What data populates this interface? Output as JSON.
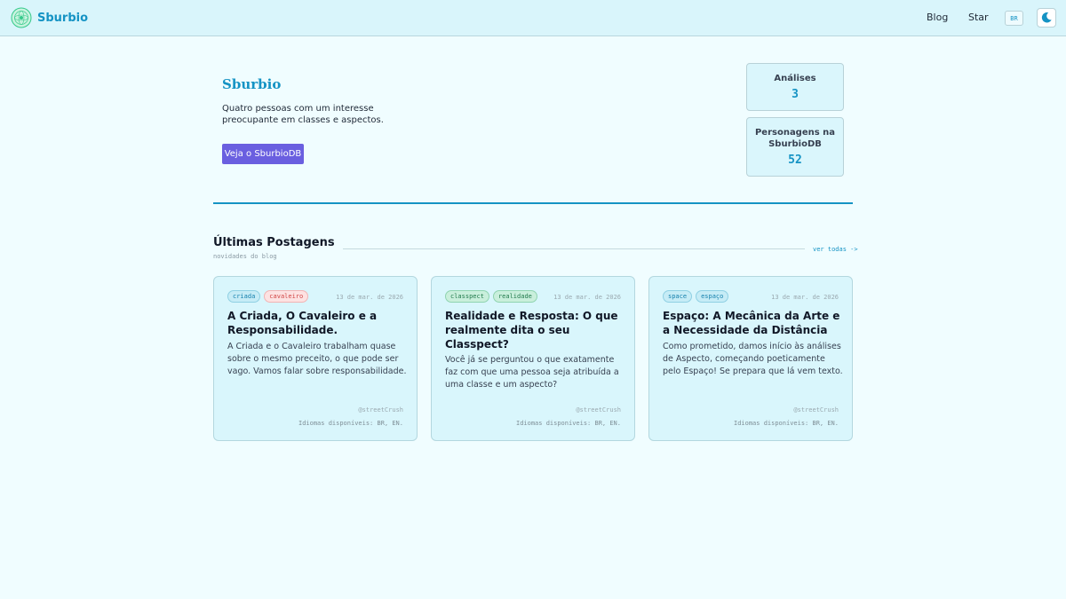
{
  "header": {
    "brand": "Sburbio",
    "nav": {
      "blog": "Blog",
      "star": "Star"
    },
    "lang_label": "BR"
  },
  "hero": {
    "title": "Sburbio",
    "description": "Quatro pessoas com um interesse preocupante em classes e aspectos.",
    "cta": "Veja o SburbioDB"
  },
  "stats": [
    {
      "label": "Análises",
      "value": "3"
    },
    {
      "label": "Personagens na SburbioDB",
      "value": "52"
    }
  ],
  "section": {
    "title": "Últimas Postagens",
    "subtitle": "novidades do blog",
    "see_all": "ver todas ->"
  },
  "posts": [
    {
      "tags": [
        "criada",
        "cavaleiro"
      ],
      "date": "13 de mar. de 2026",
      "title": "A Criada, O Cavaleiro e a Responsabilidade.",
      "excerpt": "A Criada e o Cavaleiro trabalham quase sobre o mesmo preceito, o que pode ser vago. Vamos falar sobre responsabilidade.",
      "author": "@streetCrush",
      "langs": "Idiomas disponíveis: BR, EN."
    },
    {
      "tags": [
        "classpect",
        "realidade"
      ],
      "date": "13 de mar. de 2026",
      "title": "Realidade e Resposta: O que realmente dita o seu Classpect?",
      "excerpt": "Você já se perguntou o que exatamente faz com que uma pessoa seja atribuída a uma classe e um aspecto?",
      "author": "@streetCrush",
      "langs": "Idiomas disponíveis: BR, EN."
    },
    {
      "tags": [
        "space",
        "espaço"
      ],
      "date": "13 de mar. de 2026",
      "title": "Espaço: A Mecânica da Arte e a Necessidade da Distância",
      "excerpt": "Como prometido, damos início às análises de Aspecto, começando poeticamente pelo Espaço! Se prepara que lá vem texto.",
      "author": "@streetCrush",
      "langs": "Idiomas disponíveis: BR, EN."
    }
  ],
  "colors": {
    "accent": "#1593c4",
    "button": "#6a5fe0",
    "background": "#f0fdff",
    "card": "#d9f6fc"
  },
  "icons": {
    "logo": "sburb-logo-icon",
    "theme": "moon-icon"
  }
}
